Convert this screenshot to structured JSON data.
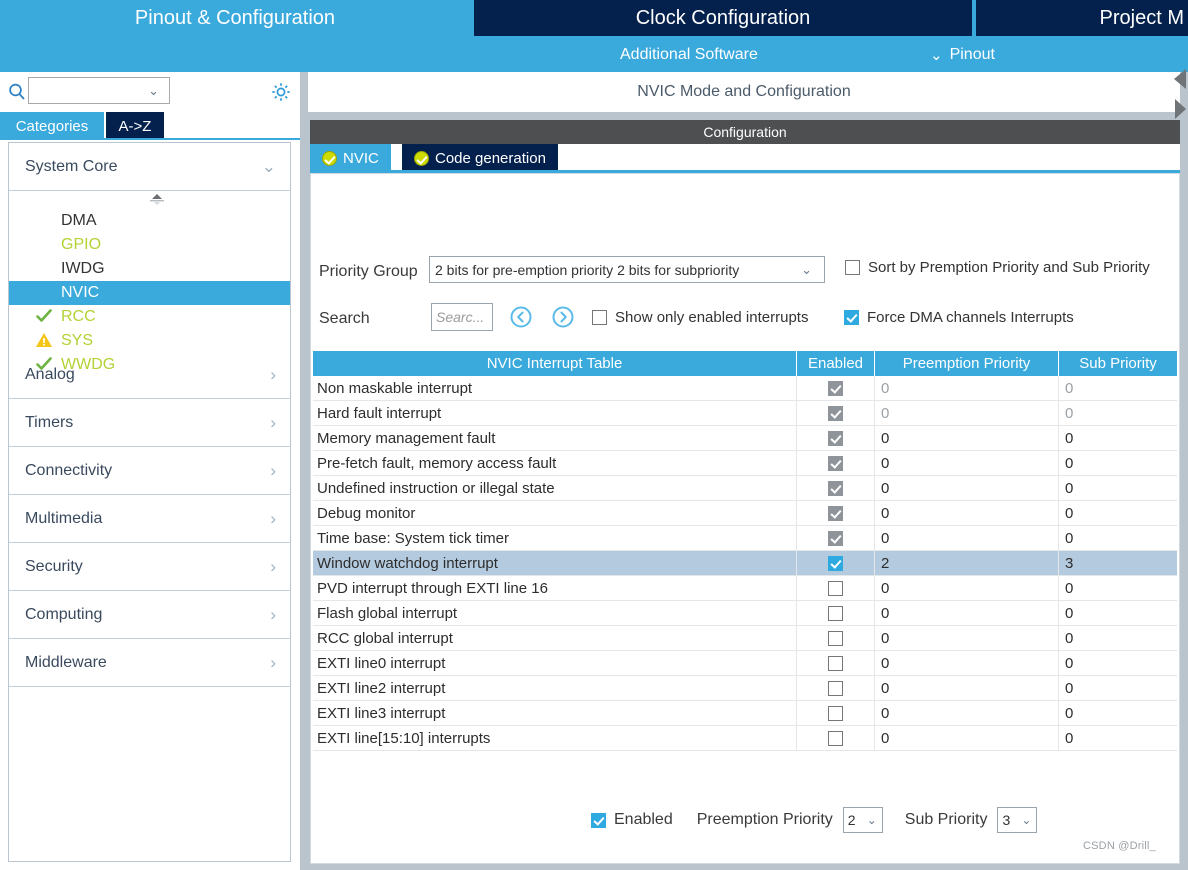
{
  "top_bar": {
    "tabs": [
      {
        "label": "Pinout & Configuration",
        "active": true
      },
      {
        "label": "Clock Configuration",
        "active": false
      },
      {
        "label": "Project M",
        "active": false
      }
    ],
    "sub_tabs": [
      {
        "label": "Additional Software"
      },
      {
        "label": "Pinout",
        "icon": "chevron-down-icon"
      }
    ],
    "colors": {
      "active_tab": "#3aa9dc",
      "inactive_tab": "#04204d"
    }
  },
  "left_panel": {
    "search": {
      "value": "",
      "placeholder": "",
      "icon": "search-icon"
    },
    "gear_icon": "gear-icon",
    "tabs": [
      {
        "label": "Categories",
        "active": true
      },
      {
        "label": "A->Z",
        "active": false
      }
    ],
    "groups": [
      {
        "label": "System Core",
        "expanded": true,
        "arrow": "chevron-down-icon"
      },
      {
        "label": "Analog",
        "expanded": false,
        "arrow": "chevron-right-icon"
      },
      {
        "label": "Timers",
        "expanded": false,
        "arrow": "chevron-right-icon"
      },
      {
        "label": "Connectivity",
        "expanded": false,
        "arrow": "chevron-right-icon"
      },
      {
        "label": "Multimedia",
        "expanded": false,
        "arrow": "chevron-right-icon"
      },
      {
        "label": "Security",
        "expanded": false,
        "arrow": "chevron-right-icon"
      },
      {
        "label": "Computing",
        "expanded": false,
        "arrow": "chevron-right-icon"
      },
      {
        "label": "Middleware",
        "expanded": false,
        "arrow": "chevron-right-icon"
      }
    ],
    "system_core_items": [
      {
        "label": "DMA",
        "mark": "none",
        "state": "normal"
      },
      {
        "label": "GPIO",
        "mark": "none",
        "state": "configured"
      },
      {
        "label": "IWDG",
        "mark": "none",
        "state": "normal"
      },
      {
        "label": "NVIC",
        "mark": "none",
        "state": "selected"
      },
      {
        "label": "RCC",
        "mark": "check",
        "state": "configured"
      },
      {
        "label": "SYS",
        "mark": "warning",
        "state": "configured"
      },
      {
        "label": "WWDG",
        "mark": "check",
        "state": "configured"
      }
    ],
    "colors": {
      "selected_bg": "#3aa9dc",
      "configured_text": "#b2d235"
    }
  },
  "right_panel": {
    "mode_config_header": "NVIC Mode and Configuration",
    "configuration_bar": "Configuration",
    "config_tabs": [
      {
        "label": "NVIC",
        "active": true,
        "icon": "check-badge-icon"
      },
      {
        "label": "Code generation",
        "active": false,
        "icon": "check-badge-icon"
      }
    ],
    "controls": {
      "priority_group_label": "Priority Group",
      "priority_group_value": "2 bits for pre-emption priority 2 bits for subpriority",
      "sort_by_label": "Sort by Premption Priority and Sub Priority",
      "sort_by_checked": false,
      "search_label": "Search",
      "search_value": "",
      "search_placeholder": "Searc...",
      "search_prev_icon": "circle-left-arrow-icon",
      "search_next_icon": "circle-right-arrow-icon",
      "show_only_enabled_label": "Show only enabled interrupts",
      "show_only_enabled_checked": false,
      "force_dma_label": "Force DMA channels Interrupts",
      "force_dma_checked": true
    },
    "table": {
      "columns": [
        "NVIC Interrupt Table",
        "Enabled",
        "Preemption Priority",
        "Sub Priority"
      ],
      "rows": [
        {
          "name": "Non maskable interrupt",
          "enabled": true,
          "locked": true,
          "preemption": "0",
          "sub": "0",
          "dim": true,
          "selected": false
        },
        {
          "name": "Hard fault interrupt",
          "enabled": true,
          "locked": true,
          "preemption": "0",
          "sub": "0",
          "dim": true,
          "selected": false
        },
        {
          "name": "Memory management fault",
          "enabled": true,
          "locked": true,
          "preemption": "0",
          "sub": "0",
          "dim": false,
          "selected": false
        },
        {
          "name": "Pre-fetch fault, memory access fault",
          "enabled": true,
          "locked": true,
          "preemption": "0",
          "sub": "0",
          "dim": false,
          "selected": false
        },
        {
          "name": "Undefined instruction or illegal state",
          "enabled": true,
          "locked": true,
          "preemption": "0",
          "sub": "0",
          "dim": false,
          "selected": false
        },
        {
          "name": "Debug monitor",
          "enabled": true,
          "locked": true,
          "preemption": "0",
          "sub": "0",
          "dim": false,
          "selected": false
        },
        {
          "name": "Time base: System tick timer",
          "enabled": true,
          "locked": true,
          "preemption": "0",
          "sub": "0",
          "dim": false,
          "selected": false
        },
        {
          "name": "Window watchdog interrupt",
          "enabled": true,
          "locked": false,
          "preemption": "2",
          "sub": "3",
          "dim": false,
          "selected": true
        },
        {
          "name": "PVD interrupt through EXTI line 16",
          "enabled": false,
          "locked": false,
          "preemption": "0",
          "sub": "0",
          "dim": false,
          "selected": false
        },
        {
          "name": "Flash global interrupt",
          "enabled": false,
          "locked": false,
          "preemption": "0",
          "sub": "0",
          "dim": false,
          "selected": false
        },
        {
          "name": "RCC global interrupt",
          "enabled": false,
          "locked": false,
          "preemption": "0",
          "sub": "0",
          "dim": false,
          "selected": false
        },
        {
          "name": "EXTI line0 interrupt",
          "enabled": false,
          "locked": false,
          "preemption": "0",
          "sub": "0",
          "dim": false,
          "selected": false
        },
        {
          "name": "EXTI line2 interrupt",
          "enabled": false,
          "locked": false,
          "preemption": "0",
          "sub": "0",
          "dim": false,
          "selected": false
        },
        {
          "name": "EXTI line3 interrupt",
          "enabled": false,
          "locked": false,
          "preemption": "0",
          "sub": "0",
          "dim": false,
          "selected": false
        },
        {
          "name": "EXTI line[15:10] interrupts",
          "enabled": false,
          "locked": false,
          "preemption": "0",
          "sub": "0",
          "dim": false,
          "selected": false
        }
      ],
      "header_bg": "#3aa9dc",
      "selected_row_bg": "#b4cade"
    },
    "bottom": {
      "enabled_label": "Enabled",
      "enabled_checked": true,
      "preemption_label": "Preemption Priority",
      "preemption_value": "2",
      "sub_label": "Sub Priority",
      "sub_value": "3"
    }
  },
  "watermark": "CSDN @Drill_"
}
